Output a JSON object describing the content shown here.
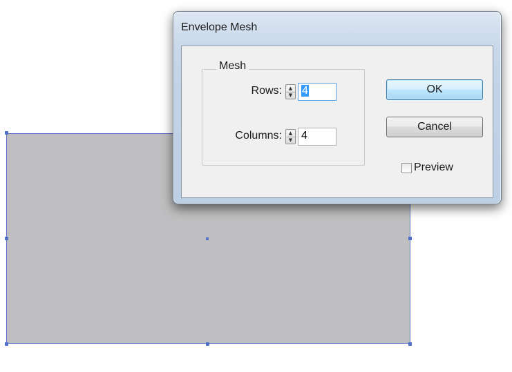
{
  "dialog": {
    "title": "Envelope Mesh",
    "group_label": "Mesh",
    "rows_label": "Rows:",
    "rows_value": "4",
    "columns_label": "Columns:",
    "columns_value": "4",
    "ok_label": "OK",
    "cancel_label": "Cancel",
    "preview_label": "Preview",
    "preview_checked": false
  },
  "icons": {
    "spinner_up": "▲",
    "spinner_down": "▼"
  },
  "colors": {
    "selection": "#3399ff",
    "shape_fill": "#bfbfc1",
    "bounding_box": "#5b76c4"
  }
}
